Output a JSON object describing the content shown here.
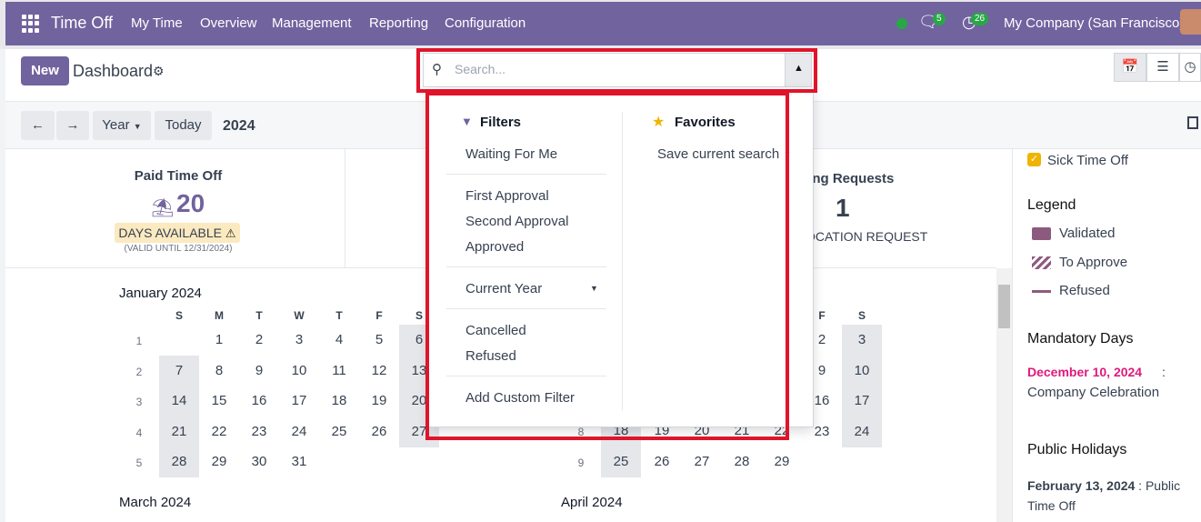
{
  "nav": {
    "app_name": "Time Off",
    "menu": [
      "My Time",
      "Overview",
      "Management",
      "Reporting",
      "Configuration"
    ],
    "messages_count": "5",
    "activities_count": "26",
    "company": "My Company (San Francisco)"
  },
  "control_panel": {
    "new_label": "New",
    "title": "Dashboard",
    "search_placeholder": "Search..."
  },
  "toolbar": {
    "scale_label": "Year",
    "today_label": "Today",
    "current_year": "2024"
  },
  "summary": {
    "pto_name": "Paid Time Off",
    "pto_days": "20",
    "days_available_label": "DAYS AVAILABLE",
    "valid_until": "(VALID UNTIL 12/31/2024)",
    "pending_title": "ding Requests",
    "pending_count": "1",
    "pending_label": "OCATION REQUEST"
  },
  "search_panel": {
    "filters_title": "Filters",
    "filters": [
      "Waiting For Me",
      "First Approval",
      "Second Approval",
      "Approved",
      "Current Year",
      "Cancelled",
      "Refused",
      "Add Custom Filter"
    ],
    "favorites_title": "Favorites",
    "save_search": "Save current search"
  },
  "calendar": {
    "dow": [
      "S",
      "M",
      "T",
      "W",
      "T",
      "F",
      "S"
    ],
    "jan": {
      "title": "January 2024",
      "weeks": [
        "1",
        "2",
        "3",
        "4",
        "5"
      ],
      "rows": [
        [
          "",
          "1",
          "2",
          "3",
          "4",
          "5",
          "6"
        ],
        [
          "7",
          "8",
          "9",
          "10",
          "11",
          "12",
          "13"
        ],
        [
          "14",
          "15",
          "16",
          "17",
          "18",
          "19",
          "20"
        ],
        [
          "21",
          "22",
          "23",
          "24",
          "25",
          "26",
          "27"
        ],
        [
          "28",
          "29",
          "30",
          "31",
          "",
          "",
          ""
        ]
      ]
    },
    "feb": {
      "dow_visible": [
        "F",
        "S"
      ],
      "rows_right": [
        [
          "2",
          "3"
        ],
        [
          "9",
          "10"
        ],
        [
          "16",
          "17"
        ],
        [
          "23",
          "24"
        ]
      ],
      "week8": "8",
      "week9": "9",
      "row8_visible": [
        "18",
        "19",
        "20",
        "21",
        "22"
      ],
      "row9": [
        "25",
        "26",
        "27",
        "28",
        "29"
      ]
    },
    "march_title": "March 2024",
    "april_title": "April 2024"
  },
  "sidebar": {
    "sick_label": "Sick Time Off",
    "legend_title": "Legend",
    "legend": [
      "Validated",
      "To Approve",
      "Refused"
    ],
    "mandatory_title": "Mandatory Days",
    "mandatory_date": "December 10, 2024",
    "mandatory_sep": " :",
    "mandatory_name": "Company Celebration",
    "public_title": "Public Holidays",
    "public_date": "February 13, 2024",
    "public_name": " : Public Time Off"
  },
  "colors": {
    "brand": "#71639e",
    "highlight_red": "#e0142a",
    "mandatory_pink": "#e0197d",
    "status_green": "#28a745"
  }
}
